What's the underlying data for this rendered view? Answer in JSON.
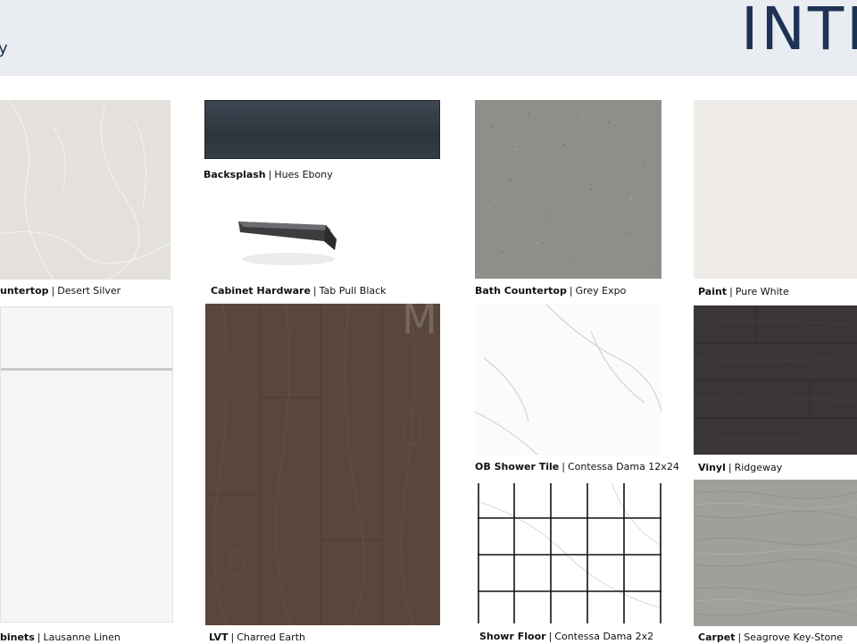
{
  "header": {
    "title": "INTE",
    "subtitle": "y"
  },
  "watermark": "MLS",
  "items": [
    {
      "name": "untertop",
      "value": "Desert Silver"
    },
    {
      "name": "Backsplash",
      "value": "Hues Ebony"
    },
    {
      "name": "Cabinet Hardware",
      "value": "Tab Pull Black"
    },
    {
      "name": "Bath Countertop",
      "value": "Grey Expo"
    },
    {
      "name": "Paint",
      "value": "Pure White"
    },
    {
      "name": "binets",
      "value": "Lausanne Linen"
    },
    {
      "name": "LVT",
      "value": "Charred Earth"
    },
    {
      "name": "OB Shower Tile",
      "value": "Contessa Dama 12x24"
    },
    {
      "name": "Vinyl",
      "value": "Ridgeway"
    },
    {
      "name": "Showr Floor",
      "value": "Contessa Dama 2x2"
    },
    {
      "name": "Carpet",
      "value": "Seagrove Key-Stone"
    }
  ],
  "separator": "|"
}
